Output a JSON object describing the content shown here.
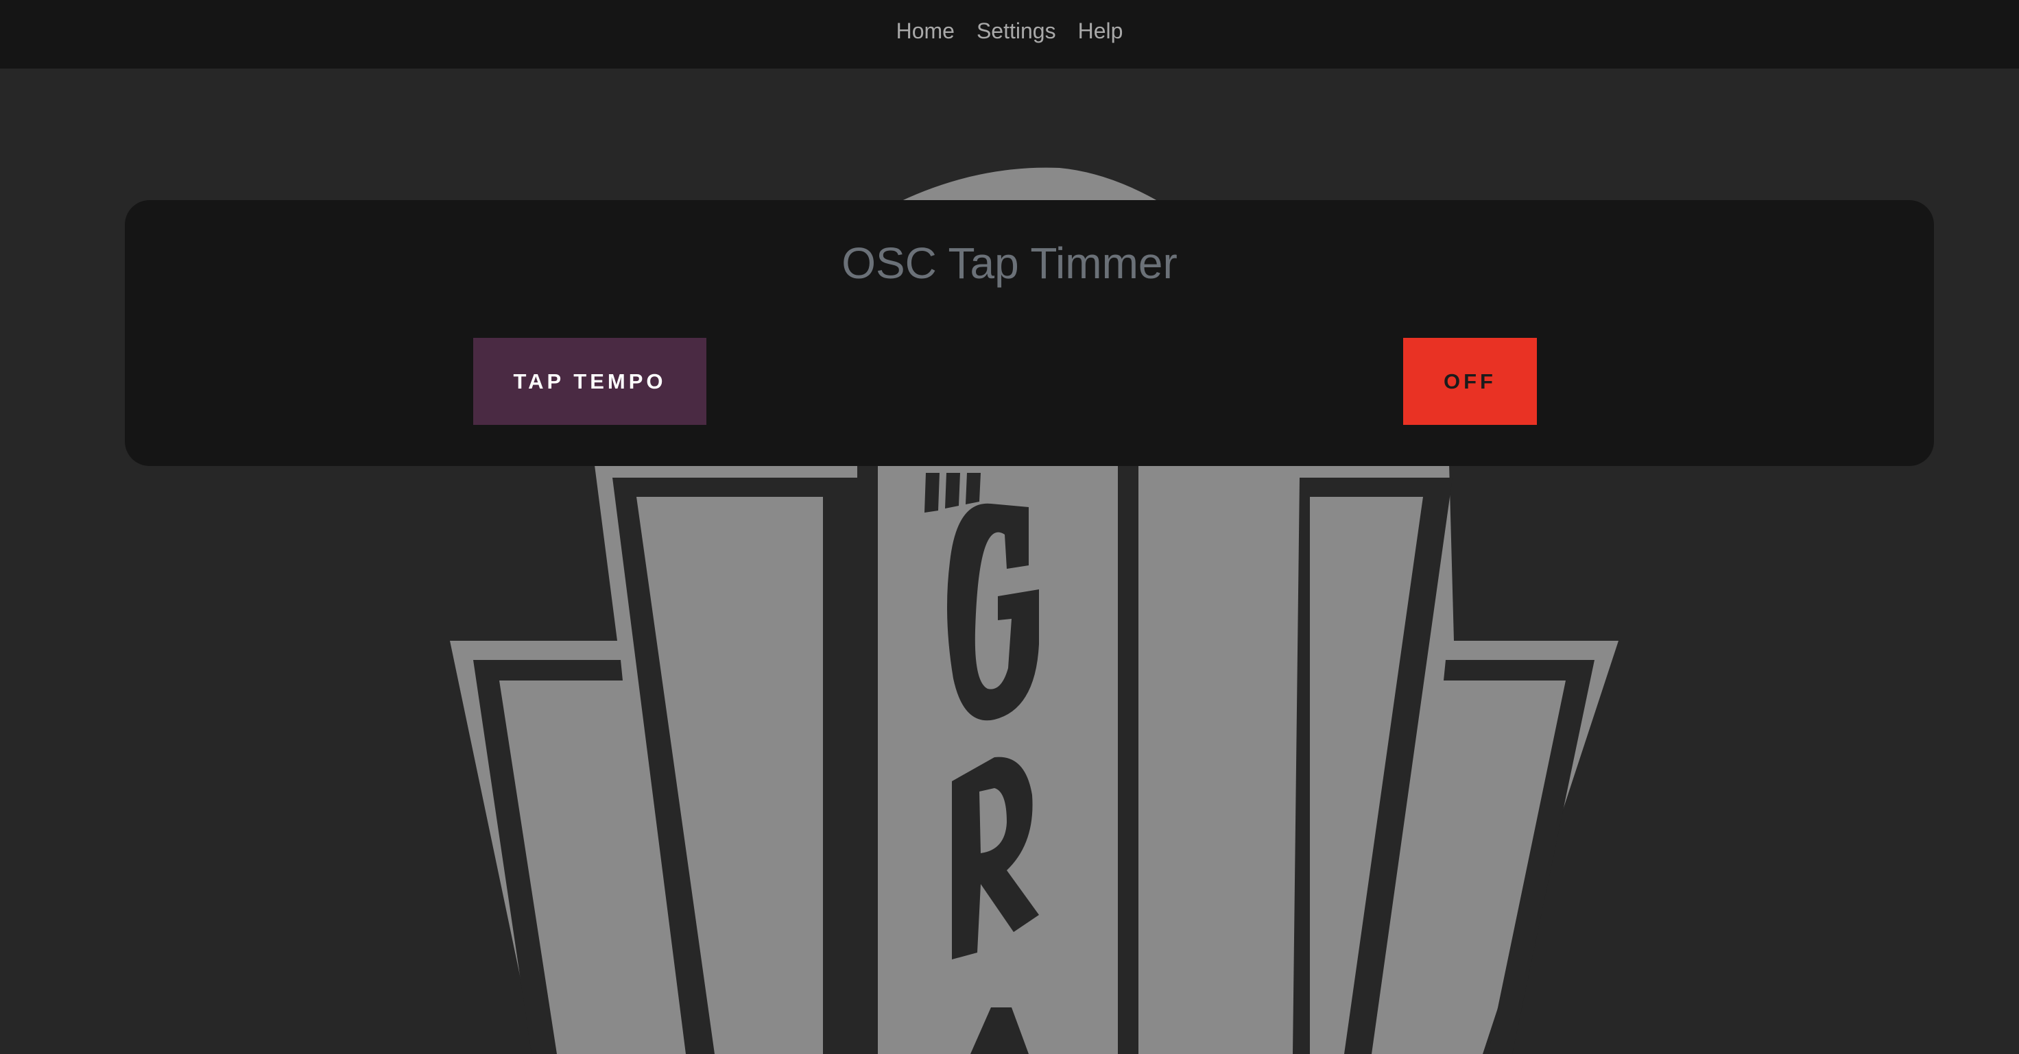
{
  "nav": {
    "items": [
      {
        "label": "Home"
      },
      {
        "label": "Settings"
      },
      {
        "label": "Help"
      }
    ]
  },
  "card": {
    "title": "OSC Tap Timmer"
  },
  "controls": {
    "tap_label": "TAP TEMPO",
    "toggle_label": "OFF"
  },
  "background": {
    "logo_icon": "emblem-logo-icon"
  },
  "colors": {
    "page_bg": "#272727",
    "nav_bg": "#151515",
    "card_bg": "#151515",
    "tap_button": "#4a2a43",
    "off_button": "#e93224",
    "emblem": "#8a8a8a"
  }
}
